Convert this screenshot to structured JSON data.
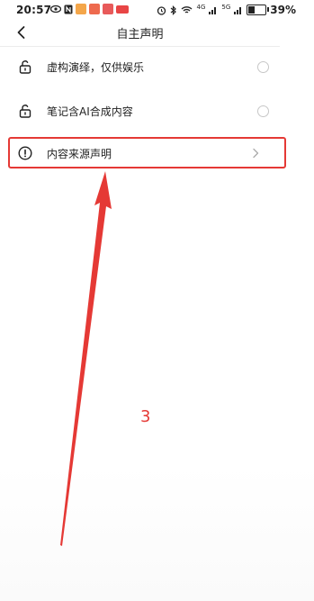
{
  "status_bar": {
    "time": "20:57",
    "battery_percent": "39%",
    "battery_level": 0.39,
    "network_labels": [
      "4G",
      "5G"
    ]
  },
  "header": {
    "title": "自主声明",
    "back_icon": "chevron-left-icon"
  },
  "options": [
    {
      "label": "虚构演绎，仅供娱乐",
      "icon": "lock-open-icon",
      "control": "radio",
      "selected": false
    },
    {
      "label": "笔记含AI合成内容",
      "icon": "lock-open-icon",
      "control": "radio",
      "selected": false
    },
    {
      "label": "内容来源声明",
      "icon": "exclamation-circle-icon",
      "control": "chevron-right",
      "highlighted": true
    }
  ],
  "annotation": {
    "step_number": "3",
    "color": "#e53935"
  }
}
